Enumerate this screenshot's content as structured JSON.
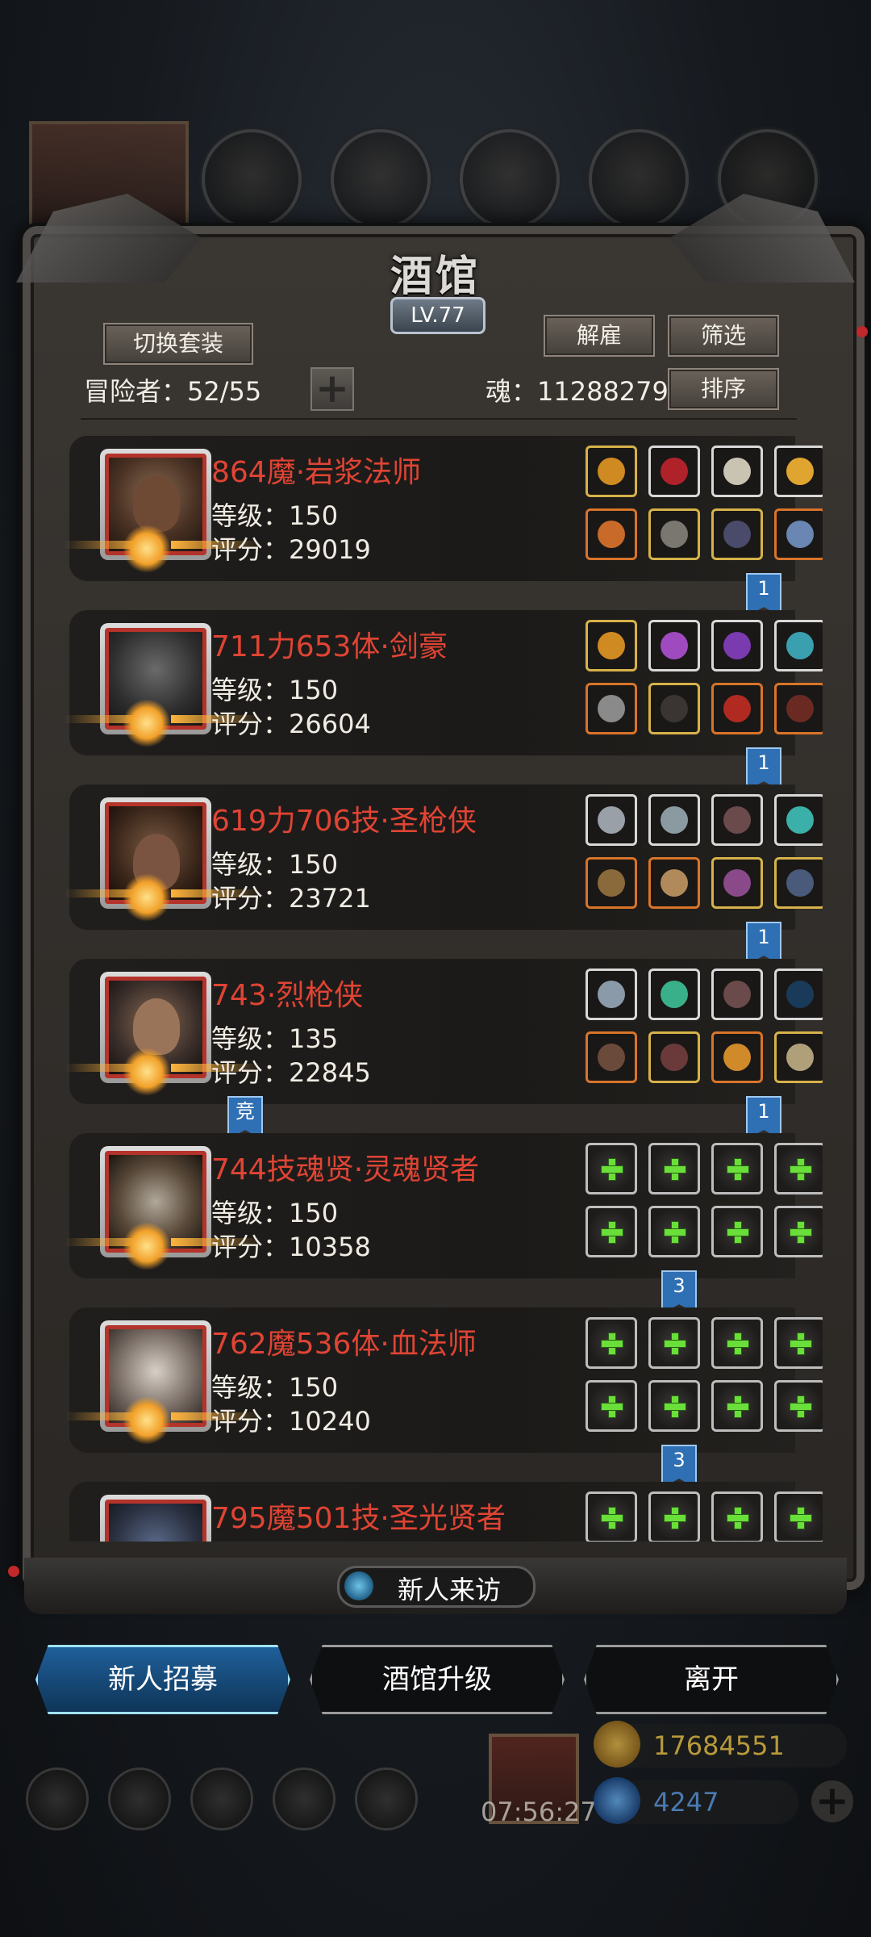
{
  "window": {
    "title": "酒馆",
    "level": "LV.77"
  },
  "toolbar": {
    "switch_outfit": "切换套装",
    "dismiss": "解雇",
    "filter": "筛选",
    "sort": "排序"
  },
  "stats": {
    "adventurers_label": "冒险者：52/55",
    "souls_label": "魂：11288279"
  },
  "heroes": [
    {
      "name": "864魔·岩浆法师",
      "level": "等级：150",
      "score": "评分：29019",
      "badge": "1",
      "has_equipment": true
    },
    {
      "name": "711力653体·剑豪",
      "level": "等级：150",
      "score": "评分：26604",
      "badge": "1",
      "has_equipment": true
    },
    {
      "name": "619力706技·圣枪侠",
      "level": "等级：150",
      "score": "评分：23721",
      "badge": "1",
      "has_equipment": true
    },
    {
      "name": "743·烈枪侠",
      "level": "等级：135",
      "score": "评分：22845",
      "badge": "1",
      "tag": "竞",
      "has_equipment": true
    },
    {
      "name": "744技魂贤·灵魂贤者",
      "level": "等级：150",
      "score": "评分：10358",
      "badge": "3",
      "has_equipment": false
    },
    {
      "name": "762魔536体·血法师",
      "level": "等级：150",
      "score": "评分：10240",
      "badge": "3",
      "has_equipment": false
    },
    {
      "name": "795魔501技·圣光贤者",
      "level": "",
      "score": "",
      "badge": "",
      "has_equipment": false
    }
  ],
  "visitor": {
    "label": "新人来访"
  },
  "actions": {
    "recruit": "新人招募",
    "upgrade": "酒馆升级",
    "leave": "离开"
  },
  "footer": {
    "timer": "07:56:27",
    "gold": "17684551",
    "gems": "4247"
  },
  "colors": {
    "hero_name": "#e04434",
    "active_button": "#1f5f9a",
    "ribbon": "#2f6fb3"
  },
  "icons": [
    "portrait-frame-icon",
    "helmet-tab-icon",
    "armor-tab-icon",
    "boots-tab-icon",
    "crystal-tab-icon",
    "anvil-tab-icon",
    "green-plus-icon",
    "visitor-clock-icon",
    "gift-icon",
    "gold-coin-icon",
    "gem-icon",
    "add-icon"
  ]
}
